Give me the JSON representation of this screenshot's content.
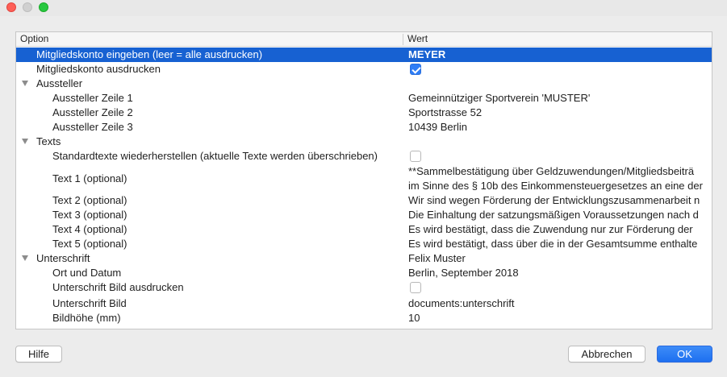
{
  "window": {
    "buttons": [
      "close",
      "minimize",
      "maximize"
    ]
  },
  "table": {
    "columns": {
      "option": "Option",
      "value": "Wert"
    },
    "rows": [
      {
        "option": "Mitgliedskonto eingeben (leer = alle ausdrucken)",
        "value": "MEYER",
        "selected": true
      },
      {
        "option": "Mitgliedskonto ausdrucken",
        "checkbox": true,
        "checked": true
      },
      {
        "option": "Aussteller",
        "group": true
      },
      {
        "option": "Aussteller Zeile 1",
        "value": "Gemeinnütziger Sportverein 'MUSTER'"
      },
      {
        "option": "Aussteller Zeile 2",
        "value": "Sportstrasse 52"
      },
      {
        "option": "Aussteller Zeile 3",
        "value": "10439 Berlin"
      },
      {
        "option": "Texts",
        "group": true
      },
      {
        "option": "Standardtexte wiederherstellen (aktuelle Texte werden überschrieben)",
        "checkbox": true,
        "checked": false
      },
      {
        "option": "Text 1 (optional)",
        "value": "**Sammelbestätigung über Geldzuwendungen/Mitgliedsbeiträ",
        "value2": "im Sinne des § 10b des Einkommensteuergesetzes an eine der"
      },
      {
        "option": "Text 2 (optional)",
        "value": "Wir sind wegen Förderung der Entwicklungszusammenarbeit n"
      },
      {
        "option": "Text 3 (optional)",
        "value": "Die Einhaltung der satzungsmäßigen Voraussetzungen nach d"
      },
      {
        "option": "Text 4 (optional)",
        "value": "Es wird bestätigt, dass die Zuwendung nur zur Förderung der"
      },
      {
        "option": "Text 5 (optional)",
        "value": "Es wird bestätigt, dass über die in der Gesamtsumme enthalte"
      },
      {
        "option": "Unterschrift",
        "group": true,
        "value": "Felix Muster"
      },
      {
        "option": "Ort und Datum",
        "value": "Berlin, September 2018"
      },
      {
        "option": "Unterschrift Bild ausdrucken",
        "checkbox": true,
        "checked": false
      },
      {
        "option": "Unterschrift Bild",
        "value": "documents:unterschrift"
      },
      {
        "option": "Bildhöhe (mm)",
        "value": "10"
      }
    ]
  },
  "buttons": {
    "help": "Hilfe",
    "cancel": "Abbrechen",
    "ok": "OK"
  },
  "colors": {
    "selection": "#1761d2",
    "primary_button": "#1e70f0",
    "checkbox_checked": "#2f7df6"
  }
}
